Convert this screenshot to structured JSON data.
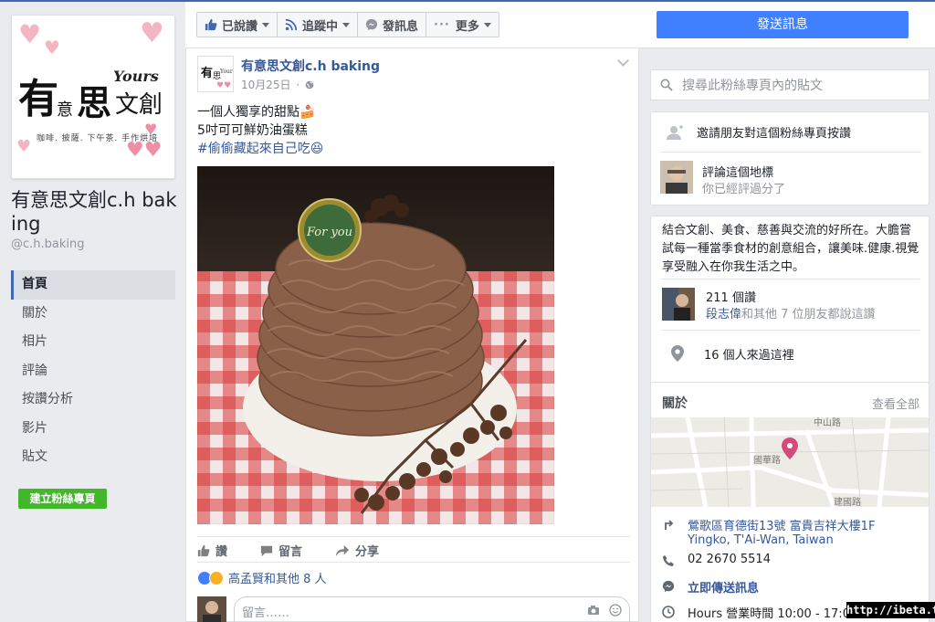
{
  "page": {
    "name": "有意思文創c.h baking",
    "handle": "@c.h.baking",
    "logo": {
      "main": "有意思文創",
      "yours": "Yours",
      "subtitle": "咖啡. 披薩. 下午茶. 手作烘培"
    }
  },
  "nav": {
    "items": [
      "首頁",
      "關於",
      "相片",
      "評論",
      "按讚分析",
      "影片",
      "貼文"
    ],
    "active": "首頁",
    "create_page": "建立粉絲專頁"
  },
  "action_bar": {
    "liked": "已說讚",
    "following": "追蹤中",
    "message": "發訊息",
    "more": "更多",
    "send_message": "發送訊息"
  },
  "post": {
    "author": "有意思文創c.h baking",
    "date": "10月25日",
    "lines": [
      "一個人獨享的甜點🍰",
      "5吋可可鮮奶油蛋糕"
    ],
    "hashtag": "#偷偷藏起來自己吃😆",
    "image_caption": "For you",
    "actions": {
      "like": "讚",
      "comment": "留言",
      "share": "分享"
    },
    "reactions_text": "高孟賢和其他 8 人",
    "comment_placeholder": "留言……"
  },
  "sidebar": {
    "search_placeholder": "搜尋此粉絲專頁內的貼文",
    "invite": "邀請朋友對這個粉絲專頁按讚",
    "review_title": "評論這個地標",
    "review_sub": "你已經評過分了",
    "about_text": "結合文創、美食、慈善與交流的好所在。大膽嘗試每一種當季食材的創意組合，讓美味.健康.視覺享受融入在你我生活之中。",
    "likes_count": "211 個讚",
    "likes_friend": "段志偉",
    "likes_friends_rest": "和其他 7 位朋友都說這讚",
    "visits": "16 個人來過這裡",
    "about_title": "關於",
    "see_all": "查看全部",
    "map_labels": {
      "road1": "中山路",
      "road2": "國華路",
      "road3": "建國路"
    },
    "address_line1": "鶯歌區育德街13號 富貴吉祥大樓1F",
    "address_line2": "Yingko, T'Ai-Wan, Taiwan",
    "phone": "02 2670 5514",
    "send_now": "立即傳送訊息",
    "hours": "Hours 營業時間 10:00 - 17:00"
  },
  "watermark": "http://ibeta.tw",
  "colors": {
    "brand": "#4267b2",
    "link": "#365899",
    "send": "#4080ff",
    "create": "#42b72a",
    "background": "#e9ebee"
  }
}
